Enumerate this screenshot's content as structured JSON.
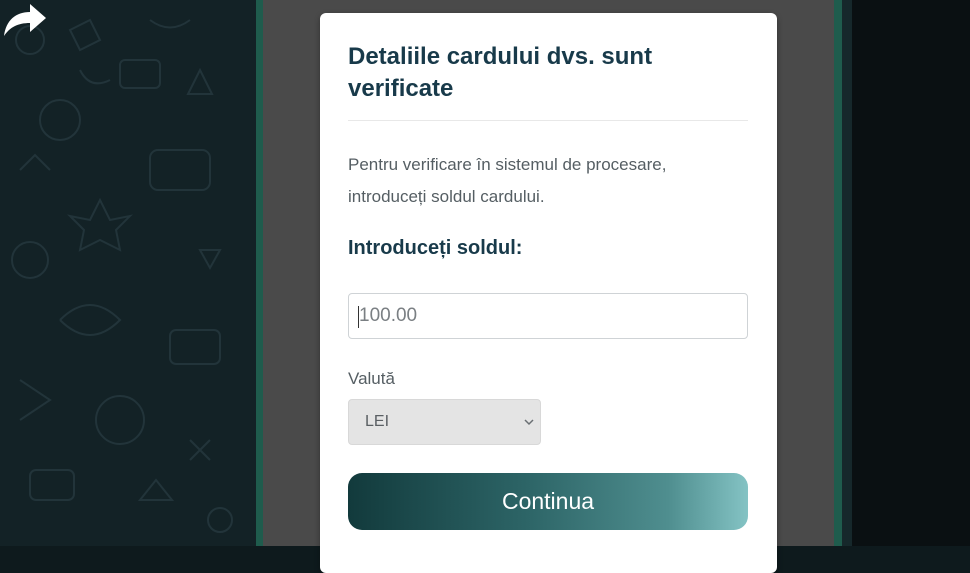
{
  "modal": {
    "title": "Detaliile cardului dvs. sunt verificate",
    "description": "Pentru verificare în sistemul de procesare, introduceți soldul cardului.",
    "balance_label": "Introduceți soldul:",
    "balance_input": {
      "value": "",
      "placeholder": "100.00"
    },
    "currency_label": "Valută",
    "currency_select": {
      "selected": "LEI"
    },
    "continue_label": "Continua"
  },
  "icons": {
    "share": "share-arrow-icon",
    "chevron": "chevron-down-icon"
  },
  "colors": {
    "title": "#183a4a",
    "button_gradient_start": "#123a3c",
    "button_gradient_end": "#84c3c4",
    "backdrop": "#4a4a4a",
    "border_accent": "#1f5c4d"
  }
}
